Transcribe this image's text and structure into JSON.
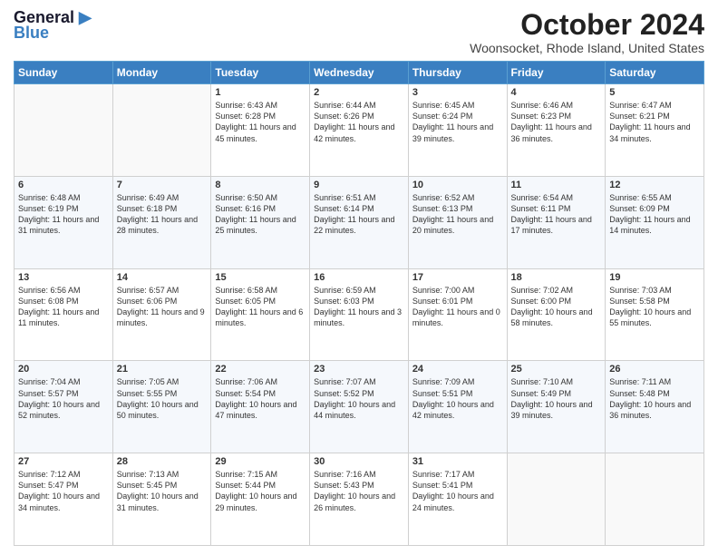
{
  "logo": {
    "line1": "General",
    "line2": "Blue"
  },
  "header": {
    "month": "October 2024",
    "location": "Woonsocket, Rhode Island, United States"
  },
  "weekdays": [
    "Sunday",
    "Monday",
    "Tuesday",
    "Wednesday",
    "Thursday",
    "Friday",
    "Saturday"
  ],
  "weeks": [
    [
      {
        "day": "",
        "info": ""
      },
      {
        "day": "",
        "info": ""
      },
      {
        "day": "1",
        "info": "Sunrise: 6:43 AM\nSunset: 6:28 PM\nDaylight: 11 hours and 45 minutes."
      },
      {
        "day": "2",
        "info": "Sunrise: 6:44 AM\nSunset: 6:26 PM\nDaylight: 11 hours and 42 minutes."
      },
      {
        "day": "3",
        "info": "Sunrise: 6:45 AM\nSunset: 6:24 PM\nDaylight: 11 hours and 39 minutes."
      },
      {
        "day": "4",
        "info": "Sunrise: 6:46 AM\nSunset: 6:23 PM\nDaylight: 11 hours and 36 minutes."
      },
      {
        "day": "5",
        "info": "Sunrise: 6:47 AM\nSunset: 6:21 PM\nDaylight: 11 hours and 34 minutes."
      }
    ],
    [
      {
        "day": "6",
        "info": "Sunrise: 6:48 AM\nSunset: 6:19 PM\nDaylight: 11 hours and 31 minutes."
      },
      {
        "day": "7",
        "info": "Sunrise: 6:49 AM\nSunset: 6:18 PM\nDaylight: 11 hours and 28 minutes."
      },
      {
        "day": "8",
        "info": "Sunrise: 6:50 AM\nSunset: 6:16 PM\nDaylight: 11 hours and 25 minutes."
      },
      {
        "day": "9",
        "info": "Sunrise: 6:51 AM\nSunset: 6:14 PM\nDaylight: 11 hours and 22 minutes."
      },
      {
        "day": "10",
        "info": "Sunrise: 6:52 AM\nSunset: 6:13 PM\nDaylight: 11 hours and 20 minutes."
      },
      {
        "day": "11",
        "info": "Sunrise: 6:54 AM\nSunset: 6:11 PM\nDaylight: 11 hours and 17 minutes."
      },
      {
        "day": "12",
        "info": "Sunrise: 6:55 AM\nSunset: 6:09 PM\nDaylight: 11 hours and 14 minutes."
      }
    ],
    [
      {
        "day": "13",
        "info": "Sunrise: 6:56 AM\nSunset: 6:08 PM\nDaylight: 11 hours and 11 minutes."
      },
      {
        "day": "14",
        "info": "Sunrise: 6:57 AM\nSunset: 6:06 PM\nDaylight: 11 hours and 9 minutes."
      },
      {
        "day": "15",
        "info": "Sunrise: 6:58 AM\nSunset: 6:05 PM\nDaylight: 11 hours and 6 minutes."
      },
      {
        "day": "16",
        "info": "Sunrise: 6:59 AM\nSunset: 6:03 PM\nDaylight: 11 hours and 3 minutes."
      },
      {
        "day": "17",
        "info": "Sunrise: 7:00 AM\nSunset: 6:01 PM\nDaylight: 11 hours and 0 minutes."
      },
      {
        "day": "18",
        "info": "Sunrise: 7:02 AM\nSunset: 6:00 PM\nDaylight: 10 hours and 58 minutes."
      },
      {
        "day": "19",
        "info": "Sunrise: 7:03 AM\nSunset: 5:58 PM\nDaylight: 10 hours and 55 minutes."
      }
    ],
    [
      {
        "day": "20",
        "info": "Sunrise: 7:04 AM\nSunset: 5:57 PM\nDaylight: 10 hours and 52 minutes."
      },
      {
        "day": "21",
        "info": "Sunrise: 7:05 AM\nSunset: 5:55 PM\nDaylight: 10 hours and 50 minutes."
      },
      {
        "day": "22",
        "info": "Sunrise: 7:06 AM\nSunset: 5:54 PM\nDaylight: 10 hours and 47 minutes."
      },
      {
        "day": "23",
        "info": "Sunrise: 7:07 AM\nSunset: 5:52 PM\nDaylight: 10 hours and 44 minutes."
      },
      {
        "day": "24",
        "info": "Sunrise: 7:09 AM\nSunset: 5:51 PM\nDaylight: 10 hours and 42 minutes."
      },
      {
        "day": "25",
        "info": "Sunrise: 7:10 AM\nSunset: 5:49 PM\nDaylight: 10 hours and 39 minutes."
      },
      {
        "day": "26",
        "info": "Sunrise: 7:11 AM\nSunset: 5:48 PM\nDaylight: 10 hours and 36 minutes."
      }
    ],
    [
      {
        "day": "27",
        "info": "Sunrise: 7:12 AM\nSunset: 5:47 PM\nDaylight: 10 hours and 34 minutes."
      },
      {
        "day": "28",
        "info": "Sunrise: 7:13 AM\nSunset: 5:45 PM\nDaylight: 10 hours and 31 minutes."
      },
      {
        "day": "29",
        "info": "Sunrise: 7:15 AM\nSunset: 5:44 PM\nDaylight: 10 hours and 29 minutes."
      },
      {
        "day": "30",
        "info": "Sunrise: 7:16 AM\nSunset: 5:43 PM\nDaylight: 10 hours and 26 minutes."
      },
      {
        "day": "31",
        "info": "Sunrise: 7:17 AM\nSunset: 5:41 PM\nDaylight: 10 hours and 24 minutes."
      },
      {
        "day": "",
        "info": ""
      },
      {
        "day": "",
        "info": ""
      }
    ]
  ]
}
